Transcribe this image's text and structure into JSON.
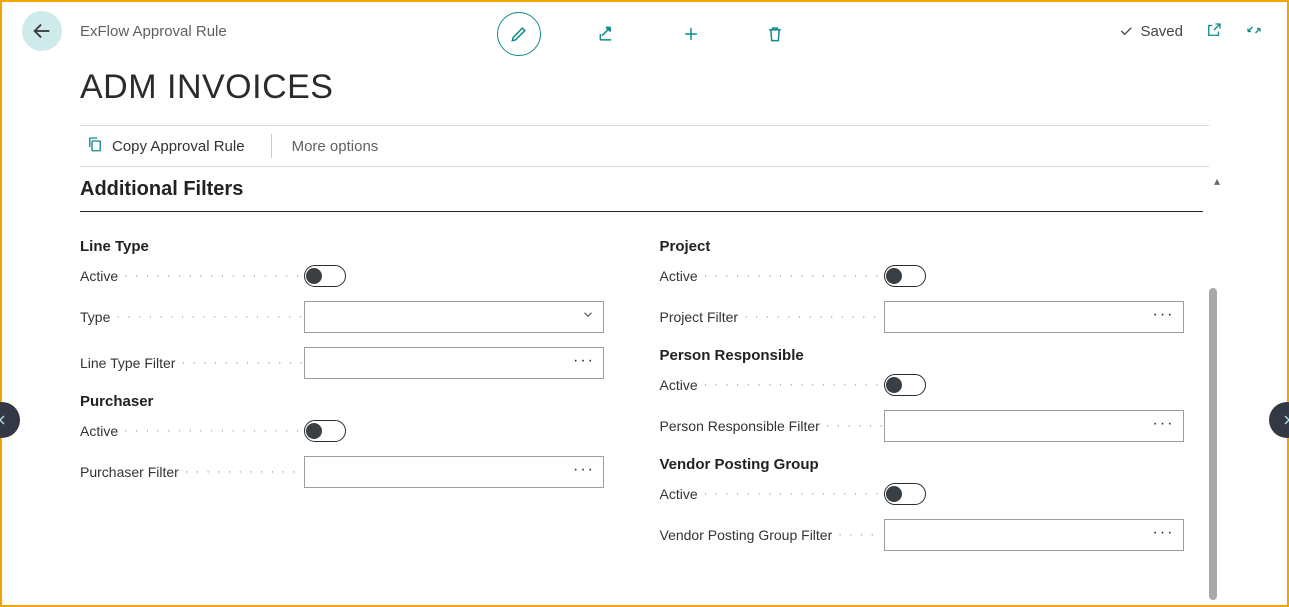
{
  "breadcrumb": "ExFlow Approval Rule",
  "page_title": "ADM INVOICES",
  "saved_status": "Saved",
  "actionbar": {
    "copy": "Copy Approval Rule",
    "more": "More options"
  },
  "section_title": "Additional Filters",
  "labels": {
    "line_type_group": "Line Type",
    "active": "Active",
    "type": "Type",
    "line_type_filter": "Line Type Filter",
    "purchaser_group": "Purchaser",
    "purchaser_filter": "Purchaser Filter",
    "project_group": "Project",
    "project_filter": "Project Filter",
    "person_resp_group": "Person Responsible",
    "person_resp_filter": "Person Responsible Filter",
    "vpg_group": "Vendor Posting Group",
    "vpg_filter": "Vendor Posting Group Filter"
  },
  "values": {
    "type": "",
    "line_type_filter": "",
    "purchaser_filter": "",
    "project_filter": "",
    "person_resp_filter": "",
    "vpg_filter": ""
  }
}
